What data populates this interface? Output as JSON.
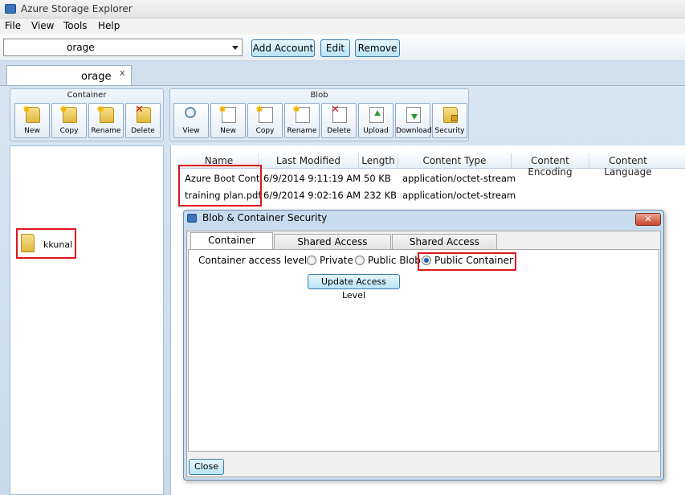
{
  "window": {
    "title": "Azure Storage Explorer"
  },
  "menu": [
    "File",
    "View",
    "Tools",
    "Help"
  ],
  "toolbar": {
    "account_value": "orage",
    "add_account": "Add Account",
    "edit": "Edit",
    "remove": "Remove"
  },
  "doc_tab": {
    "label": "orage",
    "close": "x"
  },
  "ribbon": {
    "container": {
      "title": "Container",
      "buttons": [
        "New",
        "Copy",
        "Rename",
        "Delete"
      ]
    },
    "blob": {
      "title": "Blob",
      "buttons": [
        "View",
        "New",
        "Copy",
        "Rename",
        "Delete",
        "Upload",
        "Download",
        "Security"
      ]
    }
  },
  "tree": {
    "item": "kkunal"
  },
  "blob_list": {
    "columns": [
      "Name",
      "Last Modified",
      "Length",
      "Content Type",
      "Content Encoding",
      "Content Language"
    ],
    "rows": [
      {
        "name": "Azure Boot Cont",
        "modified": "6/9/2014 9:11:19 AM",
        "length": "50 KB",
        "type": "application/octet-stream"
      },
      {
        "name": "training plan.pdf",
        "modified": "6/9/2014 9:02:16 AM",
        "length": "232 KB",
        "type": "application/octet-stream"
      }
    ]
  },
  "dialog": {
    "title": "Blob & Container Security",
    "close_glyph": "✕",
    "tabs": [
      "Container Access",
      "Shared Access Signatures",
      "Shared Access Policies"
    ],
    "access_label": "Container access level:",
    "options": [
      "Private",
      "Public Blob",
      "Public Container"
    ],
    "selected_option": "Public Container",
    "update_button": "Update Access Level",
    "close_button": "Close"
  }
}
